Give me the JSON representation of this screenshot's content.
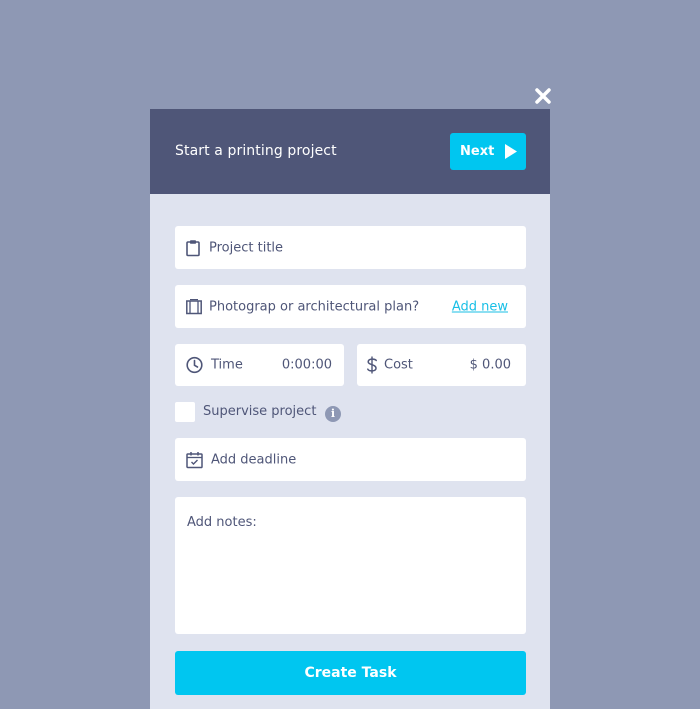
{
  "close": {
    "icon": "close-icon"
  },
  "header": {
    "title": "Start a printing project",
    "next_label": "Next",
    "next_icon": "play-icon"
  },
  "form": {
    "project_title": {
      "placeholder": "Project title",
      "icon": "clipboard-icon"
    },
    "plan": {
      "placeholder": "Photograp or architectural plan?",
      "icon": "document-icon",
      "link_label": "Add new"
    },
    "time": {
      "label": "Time",
      "value": "0:00:00",
      "icon": "clock-icon"
    },
    "cost": {
      "label": "Cost",
      "value": "$ 0.00",
      "icon": "dollar-icon"
    },
    "supervise": {
      "label": "Supervise project",
      "checked": false,
      "info_glyph": "i"
    },
    "deadline": {
      "placeholder": "Add deadline",
      "icon": "calendar-icon"
    },
    "notes": {
      "placeholder": "Add notes:"
    },
    "submit_label": "Create Task"
  },
  "colors": {
    "background": "#8e98b4",
    "header": "#4f5678",
    "panel": "#dfe3ef",
    "accent": "#00c6f0",
    "text": "#4f5678",
    "link": "#18bfe6"
  }
}
